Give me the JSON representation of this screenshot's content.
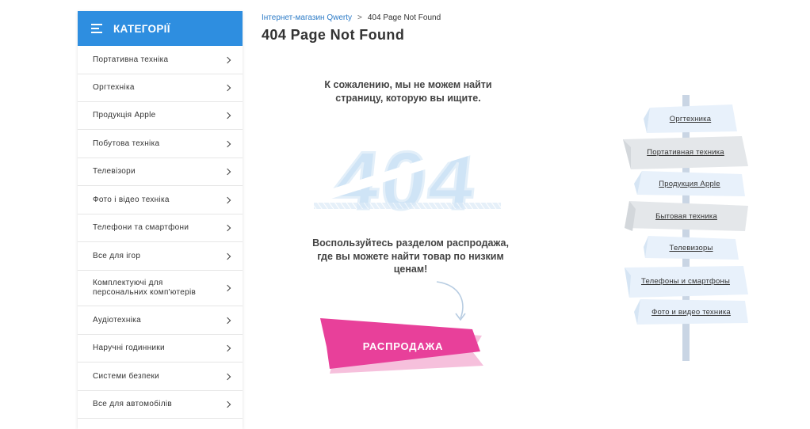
{
  "sidebar": {
    "title": "КАТЕГОРІЇ",
    "items": [
      {
        "label": "Портативна техніка"
      },
      {
        "label": "Оргтехніка"
      },
      {
        "label": "Продукція Apple"
      },
      {
        "label": "Побутова техніка"
      },
      {
        "label": "Телевізори"
      },
      {
        "label": "Фото і відео техніка"
      },
      {
        "label": "Телефони та смартфони"
      },
      {
        "label": "Все для ігор"
      },
      {
        "label": "Комплектуючі для персональних комп'ютерів"
      },
      {
        "label": "Аудіотехніка"
      },
      {
        "label": "Наручні годинники"
      },
      {
        "label": "Системи безпеки"
      },
      {
        "label": "Все для автомобілів"
      }
    ]
  },
  "breadcrumb": {
    "home": "Інтернет-магазин Qwerty",
    "separator": ">",
    "current": "404 Page Not Found"
  },
  "page_title": "404 Page Not Found",
  "main": {
    "sorry_text": "К сожалению, мы не можем найти страницу, которую вы ищите.",
    "big_number": "404",
    "hint_text": "Воспользуйтесь разделом распродажа, где вы можете найти товар по низким ценам!",
    "sale_button": "РАСПРОДАЖА"
  },
  "signpost": [
    {
      "label": "Оргтехника"
    },
    {
      "label": "Портативная техника"
    },
    {
      "label": "Продукция Apple"
    },
    {
      "label": "Бытовая техника"
    },
    {
      "label": "Телевизоры"
    },
    {
      "label": "Телефоны и смартфоны"
    },
    {
      "label": "Фото и видео техника"
    }
  ],
  "colors": {
    "accent": "#2e8ee0",
    "sale_pink": "#e8409a",
    "sign_light": "#e8f1fb",
    "sign_gray": "#e4e7ea",
    "number_blue": "#cfe4f6"
  }
}
